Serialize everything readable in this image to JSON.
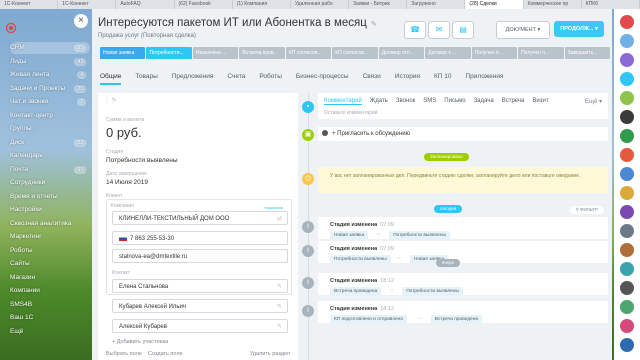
{
  "browser_tabs": [
    "1С-Коннект",
    "1С-Коннект",
    "AutoFAQ",
    "(62) Facebook",
    "(1) Компания",
    "Удаленная рабо",
    "Заявки - Битрик",
    "Загружено",
    "(28) Сделки",
    "Коммерческое пр",
    "КПКб"
  ],
  "left_menu": {
    "items": [
      {
        "label": "CRM",
        "count": "99"
      },
      {
        "label": "Лиды",
        "count": "43"
      },
      {
        "label": "Живая лента",
        "count": "4"
      },
      {
        "label": "Задачи и Проекты",
        "count": "25"
      },
      {
        "label": "Чат и звонки",
        "count": "7"
      },
      {
        "label": "Контакт-центр",
        "count": ""
      },
      {
        "label": "Группы",
        "count": ""
      },
      {
        "label": "Диск",
        "count": "22"
      },
      {
        "label": "Календарь",
        "count": ""
      },
      {
        "label": "Почта",
        "count": "99"
      },
      {
        "label": "Сотрудники",
        "count": ""
      },
      {
        "label": "Время и отчеты",
        "count": ""
      },
      {
        "label": "Настройки",
        "count": ""
      },
      {
        "label": "Сквозная аналитика",
        "count": ""
      },
      {
        "label": "Маркетинг",
        "count": ""
      },
      {
        "label": "Роботы",
        "count": ""
      },
      {
        "label": "Сайты",
        "count": ""
      },
      {
        "label": "Магазин",
        "count": ""
      },
      {
        "label": "Компании",
        "count": ""
      },
      {
        "label": "SMS4B",
        "count": ""
      },
      {
        "label": "Ваш 1С",
        "count": ""
      },
      {
        "label": "Ещё",
        "count": ""
      }
    ]
  },
  "deal": {
    "title": "Интересуются пакетом ИТ или Абонентка в месяц",
    "subtitle": "Продажа услуг (Повторная сделка)"
  },
  "header_buttons": {
    "document": "ДОКУМЕНТ",
    "go": "ПРОДОЛЖ..."
  },
  "stages": [
    {
      "label": "Новая заявка",
      "color": "#39a8ef"
    },
    {
      "label": "Потребности...",
      "color": "#2fc6f6"
    },
    {
      "label": "Назначена ...",
      "color": "#b9c3ca"
    },
    {
      "label": "Встреча пров...",
      "color": "#b9c3ca"
    },
    {
      "label": "КП согласов...",
      "color": "#b9c3ca"
    },
    {
      "label": "КП согласов...",
      "color": "#b9c3ca"
    },
    {
      "label": "Договор отп...",
      "color": "#b9c3ca"
    },
    {
      "label": "Договор к ...",
      "color": "#b9c3ca"
    },
    {
      "label": "Получен п...",
      "color": "#b9c3ca"
    },
    {
      "label": "Получен п...",
      "color": "#b9c3ca"
    },
    {
      "label": "Завершить...",
      "color": "#b9c3ca"
    }
  ],
  "tabs": [
    "Общие",
    "Товары",
    "Предложения",
    "Счета",
    "Роботы",
    "Бизнес-процессы",
    "Связи",
    "История",
    "КП 10",
    "Приложения"
  ],
  "card": {
    "amount_label": "Сумма и валюта",
    "amount": "0 руб.",
    "stage_label": "Стадия",
    "stage": "Потребности выявлены",
    "close_label": "Дата завершения",
    "close_date": "14 Июля 2019",
    "client_label": "Клиент",
    "company_label": "Компания",
    "company_tag": "подсказки",
    "company": "КЛИНЕЛЛИ-ТЕКСТИЛЬНЫЙ ДОМ ООО",
    "phone": "7 863 255-53-30",
    "email": "stalnova-ea@dmtextile.ru",
    "contact_label": "Контакт",
    "contacts": [
      "Елена Стальнова",
      "Кубарев Алексей Ильич",
      "Алексей Кубарев"
    ],
    "add_participant": "+ Добавить участника",
    "select_field": "Выбрать поле",
    "create_field": "Создать поле",
    "delete_section": "Удалить раздел"
  },
  "timeline": {
    "tabs": [
      "Комментарий",
      "Ждать",
      "Звонок",
      "SMS",
      "Письмо",
      "Задача",
      "Встреча",
      "Визит"
    ],
    "more": "Ещё",
    "placeholder": "Оставьте комментарий",
    "invite": "Пригласить к обсуждению",
    "planned_pill": "Запланировано",
    "plan_text": "У вас нет запланированных дел. Передвиньте стадию сделки, запланируйте дело или поставьте ожидание.",
    "today_pill": "сегодня",
    "filter": "ФИЛЬТР",
    "yesterday_pill": "вчера",
    "events": [
      {
        "title": "Стадия изменена",
        "time": "07:09",
        "from": "Новая заявка",
        "to": "Потребности выявлены"
      },
      {
        "title": "Стадия изменена",
        "time": "07:09",
        "from": "Потребности выявлены",
        "to": "Новая заявка"
      },
      {
        "title": "Стадия изменена",
        "time": "18:12",
        "from": "Встреча проведена",
        "to": "Потребности выявлены"
      },
      {
        "title": "Стадия изменена",
        "time": "18:12",
        "from": "КП подготовлено и отправлено",
        "to": "Встреча проведена"
      }
    ]
  },
  "right_icons": [
    "#e04a4a",
    "#6fb1e6",
    "#8a6bd4",
    "#2fc6f6",
    "#8fc44a",
    "#3a3a3a",
    "#2d9b4a",
    "#e35a3c",
    "#4a88d4",
    "#dba83a",
    "#7a4ab0",
    "#6b7a86",
    "#b06e3a",
    "#3aa3b0",
    "#555",
    "#4aa56e",
    "#d44a7a",
    "#2c6bb0"
  ]
}
